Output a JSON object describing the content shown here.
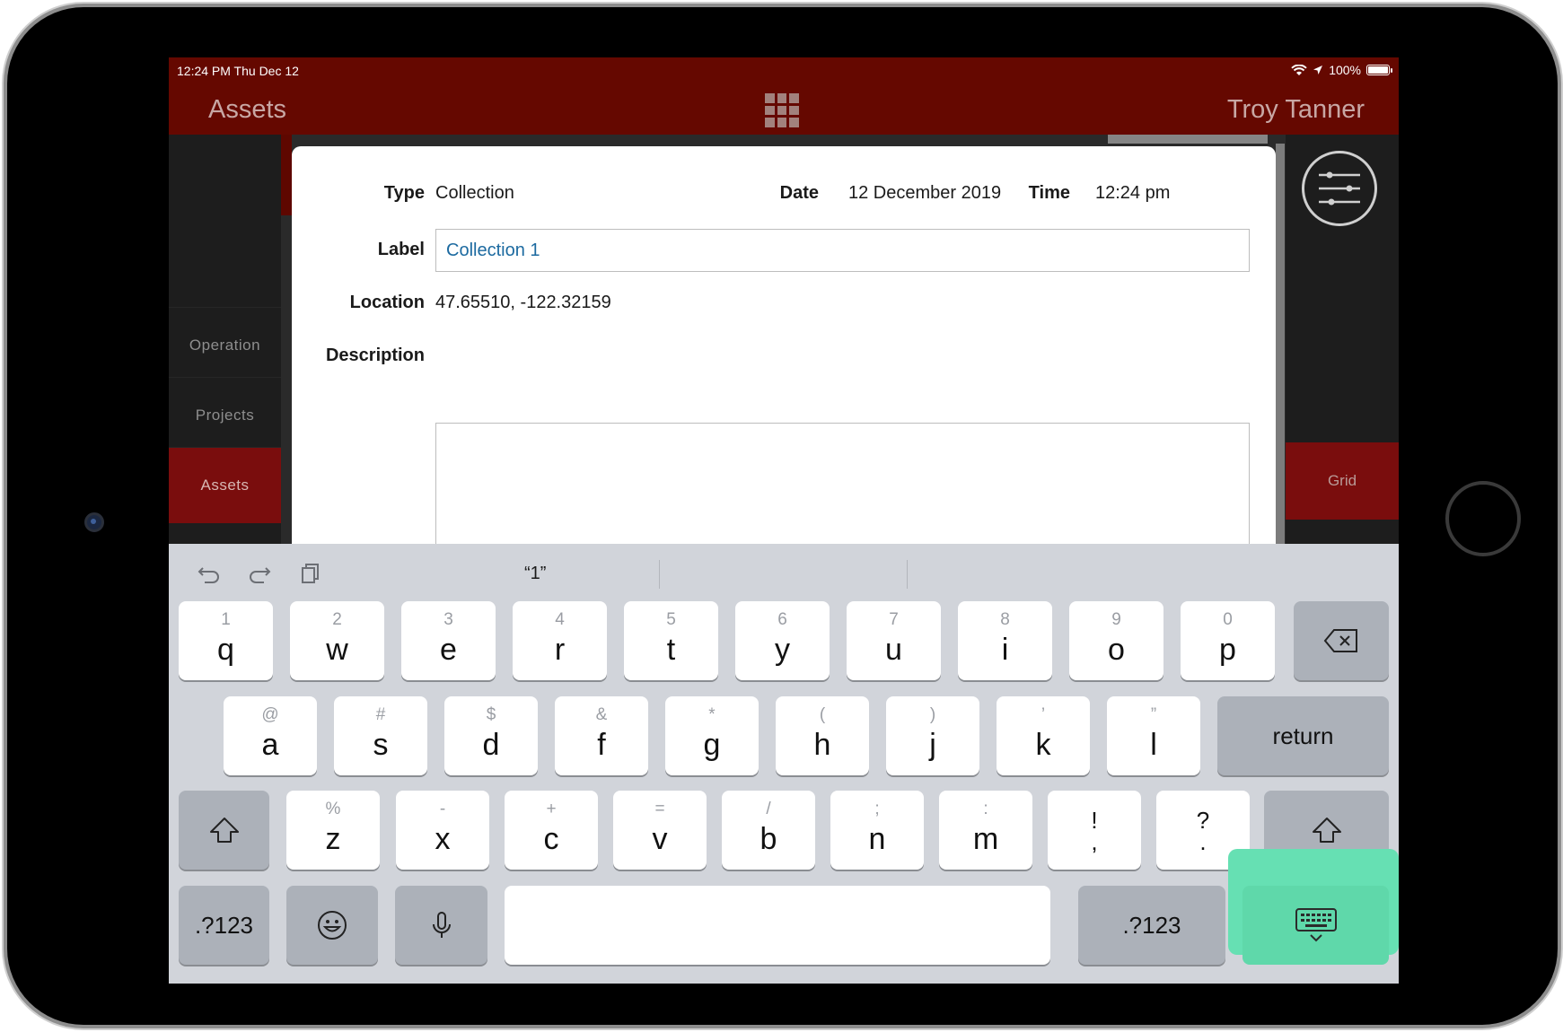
{
  "status_bar": {
    "time": "12:24 PM   Thu Dec 12",
    "battery": "100%"
  },
  "nav": {
    "title": "Assets",
    "user": "Troy Tanner",
    "grid_icon": "grid-icon"
  },
  "side_nav": {
    "items": [
      {
        "label": "Operation"
      },
      {
        "label": "Projects"
      },
      {
        "label": "Assets"
      }
    ]
  },
  "right_panel": {
    "grid_label": "Grid",
    "filter_icon": "sliders-icon"
  },
  "form": {
    "type_label": "Type",
    "type_value": "Collection",
    "date_label": "Date",
    "date_value": "12 December 2019",
    "time_label": "Time",
    "time_value": "12:24 pm",
    "label_label": "Label",
    "label_value": "Collection 1",
    "location_label": "Location",
    "location_value": "47.65510, -122.32159",
    "description_label": "Description",
    "description_value": ""
  },
  "keyboard": {
    "suggestion": "“1”",
    "row1": [
      {
        "hint": "1",
        "key": "q"
      },
      {
        "hint": "2",
        "key": "w"
      },
      {
        "hint": "3",
        "key": "e"
      },
      {
        "hint": "4",
        "key": "r"
      },
      {
        "hint": "5",
        "key": "t"
      },
      {
        "hint": "6",
        "key": "y"
      },
      {
        "hint": "7",
        "key": "u"
      },
      {
        "hint": "8",
        "key": "i"
      },
      {
        "hint": "9",
        "key": "o"
      },
      {
        "hint": "0",
        "key": "p"
      }
    ],
    "row2": [
      {
        "hint": "@",
        "key": "a"
      },
      {
        "hint": "#",
        "key": "s"
      },
      {
        "hint": "$",
        "key": "d"
      },
      {
        "hint": "&",
        "key": "f"
      },
      {
        "hint": "*",
        "key": "g"
      },
      {
        "hint": "(",
        "key": "h"
      },
      {
        "hint": ")",
        "key": "j"
      },
      {
        "hint": "’",
        "key": "k"
      },
      {
        "hint": "”",
        "key": "l"
      }
    ],
    "row3": [
      {
        "hint": "%",
        "key": "z"
      },
      {
        "hint": "-",
        "key": "x"
      },
      {
        "hint": "+",
        "key": "c"
      },
      {
        "hint": "=",
        "key": "v"
      },
      {
        "hint": "/",
        "key": "b"
      },
      {
        "hint": ";",
        "key": "n"
      },
      {
        "hint": ":",
        "key": "m"
      }
    ],
    "punct": [
      {
        "top": "!",
        "bottom": ","
      },
      {
        "top": "?",
        "bottom": "."
      }
    ],
    "return_label": "return",
    "numbers_label": ".?123",
    "highlight_color": "#66e0b3"
  }
}
